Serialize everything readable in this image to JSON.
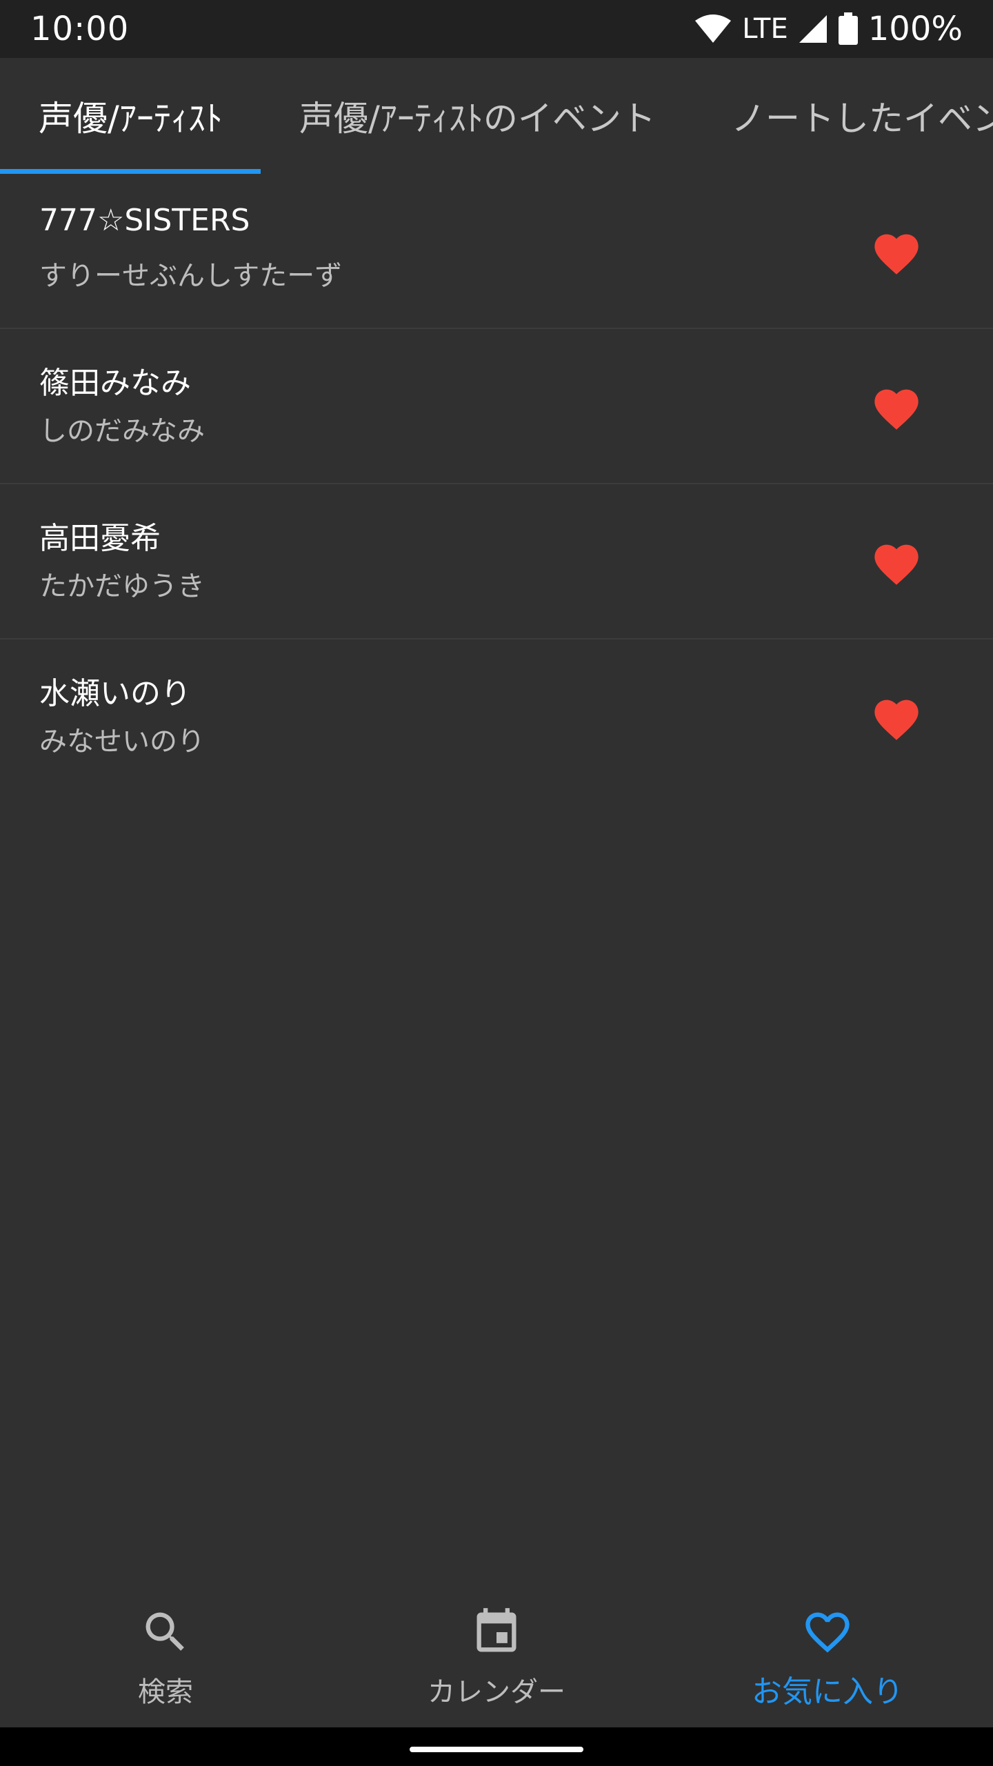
{
  "status_bar": {
    "time": "10:00",
    "network": "LTE",
    "battery": "100%"
  },
  "tabs": [
    {
      "label": "声優/ｱｰﾃｨｽﾄ",
      "active": true
    },
    {
      "label": "声優/ｱｰﾃｨｽﾄのイベント",
      "active": false
    },
    {
      "label": "ノートしたイベント",
      "active": false
    }
  ],
  "favorites": [
    {
      "name": "777☆SISTERS",
      "kana": "すりーせぶんしすたーず",
      "favorited": true
    },
    {
      "name": "篠田みなみ",
      "kana": "しのだみなみ",
      "favorited": true
    },
    {
      "name": "高田憂希",
      "kana": "たかだゆうき",
      "favorited": true
    },
    {
      "name": "水瀬いのり",
      "kana": "みなせいのり",
      "favorited": true
    }
  ],
  "bottom_nav": [
    {
      "label": "検索",
      "icon": "search-icon",
      "active": false
    },
    {
      "label": "カレンダー",
      "icon": "calendar-icon",
      "active": false
    },
    {
      "label": "お気に入り",
      "icon": "heart-outline-icon",
      "active": true
    }
  ],
  "colors": {
    "background": "#303030",
    "status_bar": "#212121",
    "accent": "#2196f3",
    "heart": "#f44336"
  }
}
